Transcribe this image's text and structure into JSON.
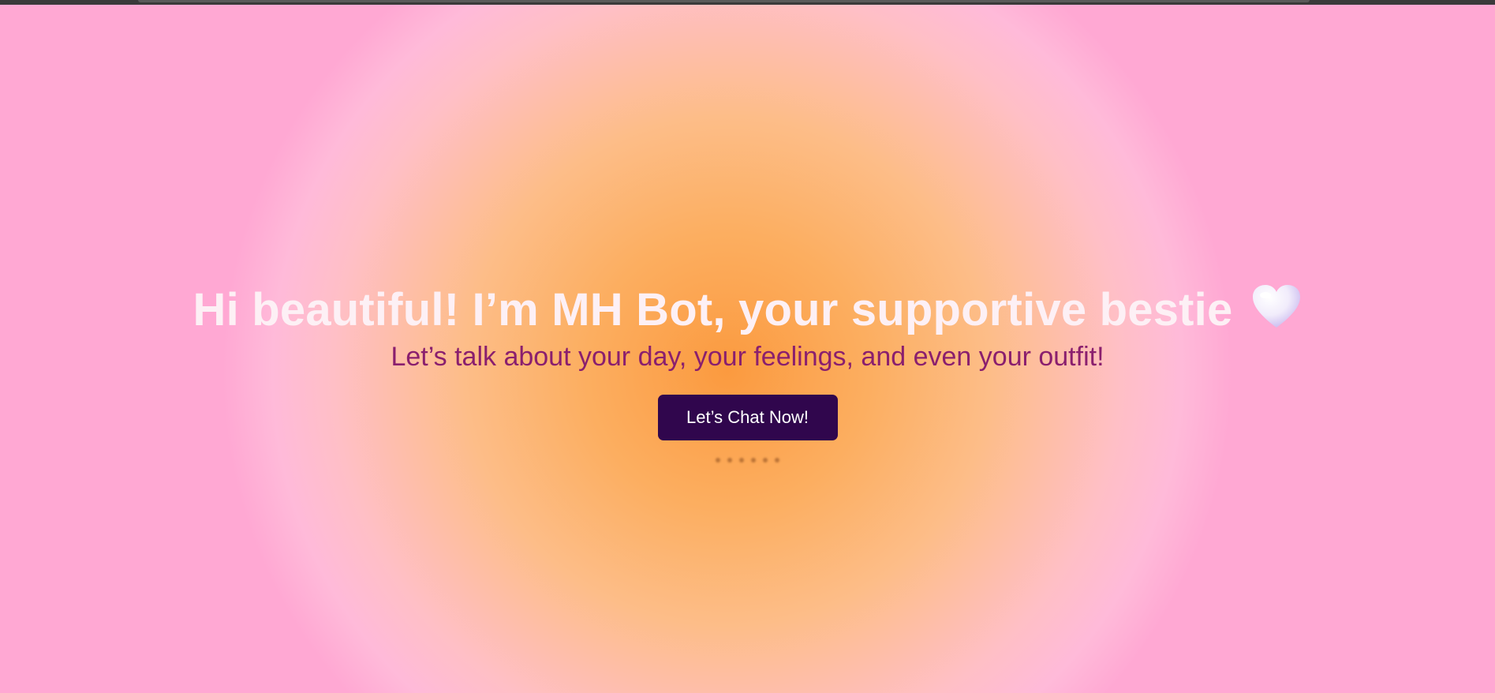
{
  "hero": {
    "title": "Hi beautiful! I’m MH Bot, your supportive bestie",
    "title_icon": "white-heart-icon",
    "subtitle": "Let’s talk about your day, your feelings, and even your outfit!",
    "cta_label": "Let’s Chat Now!"
  },
  "colors": {
    "background_center": "#fb9a3f",
    "background_edge": "#ffa8d3",
    "title_text": "#fdf0f5",
    "subtitle_text": "#8a1f6e",
    "button_bg": "#30064d",
    "button_text": "#ffffff"
  }
}
